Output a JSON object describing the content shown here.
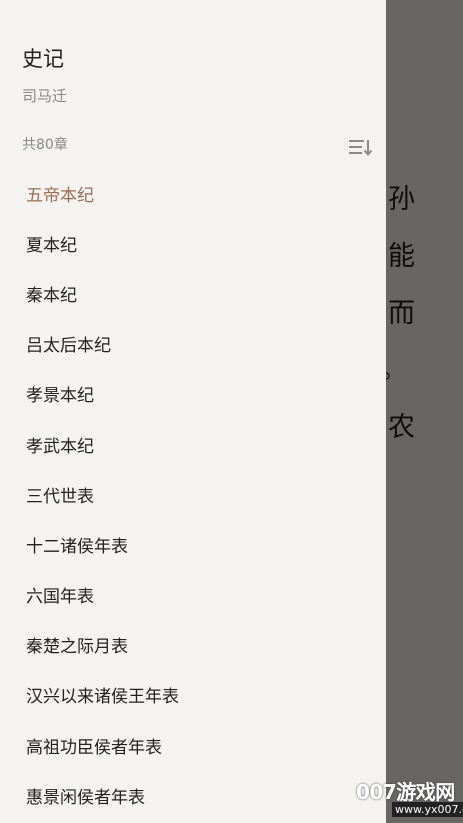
{
  "book": {
    "title": "史记",
    "author": "司马迁"
  },
  "toc": {
    "chapter_count_label": "共80章",
    "sort_icon": "sort-descending-icon",
    "active_index": 0,
    "chapters": [
      "五帝本纪",
      "夏本纪",
      "秦本纪",
      "吕太后本纪",
      "孝景本纪",
      "孝武本纪",
      "三代世表",
      "十二诸侯年表",
      "六国年表",
      "秦楚之际月表",
      "汉兴以来诸侯王年表",
      "高祖功臣侯者年表",
      "惠景闲侯者年表"
    ]
  },
  "reader_background": {
    "lines": [
      "孙",
      "能",
      "而",
      "。",
      "农"
    ]
  },
  "watermark": {
    "text": "007游戏网",
    "url": "www.yx007.com"
  },
  "colors": {
    "drawer_bg": "#f5f3ef",
    "active_chapter": "#9a6d55",
    "text_primary": "#222222",
    "text_secondary": "#888888"
  }
}
